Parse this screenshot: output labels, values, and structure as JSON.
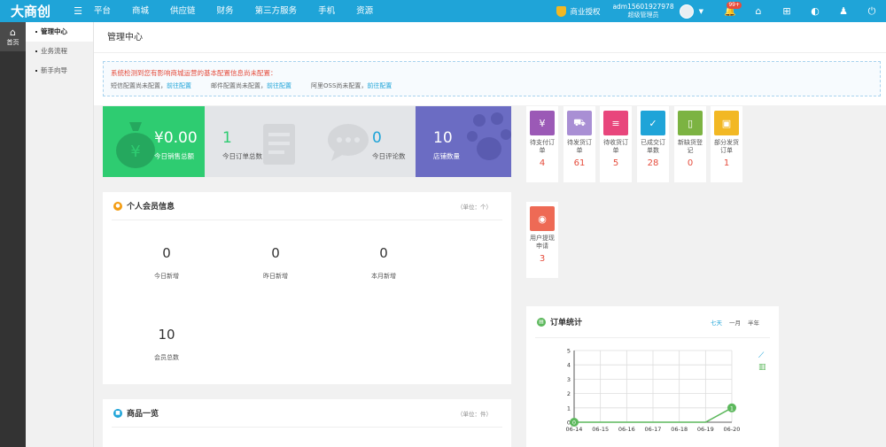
{
  "brand": {
    "logo": "大商创"
  },
  "topnav": [
    "平台",
    "商城",
    "供应链",
    "财务",
    "第三方服务",
    "手机",
    "资源"
  ],
  "topright": {
    "license": "商业授权",
    "username": "adm15601927978",
    "role": "超级管理员",
    "badge": "99+"
  },
  "rail": {
    "home_label": "首页"
  },
  "submenu": [
    {
      "label": "管理中心",
      "active": true
    },
    {
      "label": "业务流程",
      "active": false
    },
    {
      "label": "新手向导",
      "active": false
    }
  ],
  "page_title": "管理中心",
  "notice": {
    "warning": "系统检测到您有影响商城运营的基本配置信息尚未配置：",
    "items": [
      {
        "text": "短信配置尚未配置，",
        "link": "前往配置"
      },
      {
        "text": "邮件配置尚未配置，",
        "link": "前往配置"
      },
      {
        "text": "阿里OSS尚未配置，",
        "link": "前往配置"
      }
    ]
  },
  "tiles": [
    {
      "value": "¥0.00",
      "label": "今日销售总额",
      "color": "#2ecc71"
    },
    {
      "value": "1",
      "label": "今日订单总数",
      "color": "#e3e5e8"
    },
    {
      "value": "0",
      "label": "今日评论数",
      "color": "#e3e5e8"
    },
    {
      "value": "10",
      "label": "店铺数量",
      "color": "#6b6cc3"
    }
  ],
  "members": {
    "title": "个人会员信息",
    "unit": "（单位：个）",
    "stats": [
      {
        "value": "0",
        "label": "今日新增"
      },
      {
        "value": "0",
        "label": "昨日新增"
      },
      {
        "value": "0",
        "label": "本月新增"
      },
      {
        "value": "10",
        "label": "会员总数"
      }
    ]
  },
  "goods": {
    "title": "商品一览",
    "unit": "（单位：件）"
  },
  "order_shortcuts": [
    {
      "label1": "待支付订",
      "label2": "单",
      "count": "4",
      "color": "#9b59b6",
      "icon": "money-bag-icon"
    },
    {
      "label1": "待发货订",
      "label2": "单",
      "count": "61",
      "color": "#a98fd4",
      "icon": "truck-icon"
    },
    {
      "label1": "待收货订",
      "label2": "单",
      "count": "5",
      "color": "#e8467c",
      "icon": "document-icon"
    },
    {
      "label1": "已成交订",
      "label2": "单数",
      "count": "28",
      "color": "#1fa4d8",
      "icon": "clipboard-check-icon"
    },
    {
      "label1": "新缺货登",
      "label2": "记",
      "count": "0",
      "color": "#7cb342",
      "icon": "notebook-icon"
    },
    {
      "label1": "部分发货",
      "label2": "订单",
      "count": "1",
      "color": "#f2b824",
      "icon": "package-icon"
    },
    {
      "label1": "用户提现",
      "label2": "申请",
      "count": "3",
      "color": "#ee6a55",
      "icon": "coin-icon"
    }
  ],
  "order_chart_panel": {
    "title": "订单统计",
    "ranges": [
      "七天",
      "一月",
      "半年"
    ],
    "active_range": "七天"
  },
  "chart_data": {
    "type": "line",
    "x": [
      "06-14",
      "06-15",
      "06-16",
      "06-17",
      "06-18",
      "06-19",
      "06-20"
    ],
    "series": [
      {
        "values": [
          0,
          0,
          0,
          0,
          0,
          0,
          1
        ],
        "color": "#5cb85c"
      }
    ],
    "ylim": [
      0,
      5
    ],
    "yticks": [
      0,
      1,
      2,
      3,
      4,
      5
    ],
    "grid": true
  }
}
